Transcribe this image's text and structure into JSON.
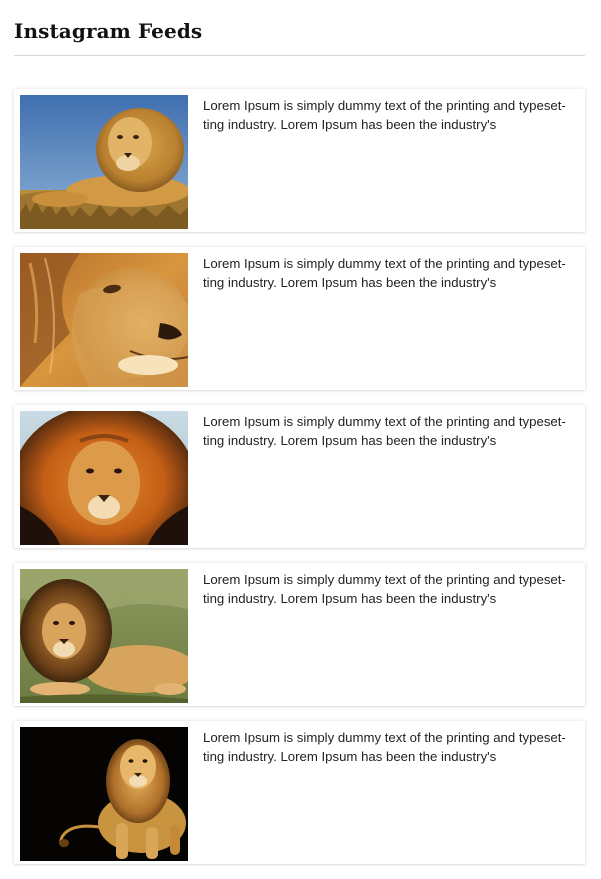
{
  "widget": {
    "title": "Instagram Feeds"
  },
  "feeds": [
    {
      "text": "Lorem Ipsum is simply dummy text of the printing and typeset-ting industry. Lorem Ipsum has been the industry's",
      "image": "lion-lying-blue-sky"
    },
    {
      "text": "Lorem Ipsum is simply dummy text of the printing and typeset-ting industry. Lorem Ipsum has been the industry's",
      "image": "lion-profile-closeup"
    },
    {
      "text": "Lorem Ipsum is simply dummy text of the printing and typeset-ting industry. Lorem Ipsum has been the industry's",
      "image": "lion-face-mane-front"
    },
    {
      "text": "Lorem Ipsum is simply dummy text of the printing and typeset-ting industry. Lorem Ipsum has been the industry's",
      "image": "lion-resting-grass"
    },
    {
      "text": "Lorem Ipsum is simply dummy text of the printing and typeset-ting industry. Lorem Ipsum has been the industry's",
      "image": "lion-walking-black-background"
    }
  ],
  "colors": {
    "title": "#111111",
    "text": "#222222",
    "rule": "#d8d8d8",
    "card_bg": "#ffffff"
  }
}
